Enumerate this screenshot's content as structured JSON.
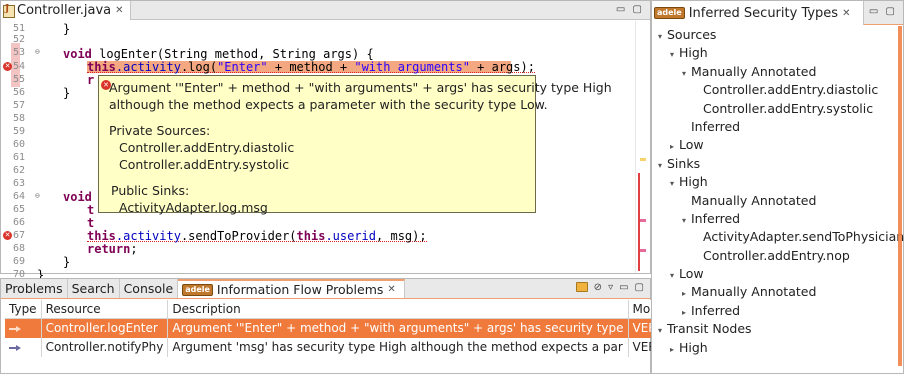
{
  "editor": {
    "tab_title": "Controller.java",
    "tab_close": "✕",
    "window_controls": "▭ ▢",
    "line_numbers": [
      "51",
      "52",
      "53",
      "54",
      "55",
      "56",
      "57",
      "58",
      "59",
      "60",
      "61",
      "62",
      "63",
      "64",
      "65",
      "66",
      "67",
      "68",
      "69",
      "70"
    ],
    "code": {
      "l51": "}",
      "l53_kw": "void",
      "l53_rest": " logEnter(String method, String args) {",
      "l54_this": "this",
      "l54_fld": ".activity",
      "l54_a": ".log(",
      "l54_s1": "\"Enter\"",
      "l54_b": " + method + ",
      "l54_s2": "\"with arguments\"",
      "l54_c": " + args);",
      "l55": "r",
      "l56": "}",
      "l64_kw": "void",
      "l65": "t",
      "l66": "t",
      "l67_this": "this",
      "l67_fld": ".activity",
      "l67_a": ".sendToProvider(",
      "l67_this2": "this",
      "l67_fld2": ".userid",
      "l67_b": ", msg);",
      "l68_kw": "return",
      "l68_b": ";",
      "l69": "}",
      "l70": "}"
    },
    "tooltip": {
      "line1": "Argument '\"Enter\" + method + \"with arguments\" + args' has security type High",
      "line2": "although the method expects a parameter with the security type Low.",
      "private_heading": "Private Sources:",
      "private_1": "Controller.addEntry.diastolic",
      "private_2": "Controller.addEntry.systolic",
      "public_heading": "Public Sinks:",
      "public_1": "ActivityAdapter.log.msg"
    }
  },
  "bottom_panel": {
    "tabs": [
      "Problems",
      "Search",
      "Console"
    ],
    "active_tab_badge": "adele",
    "active_tab": "Information Flow Problems",
    "active_tab_close": "✕",
    "columns": [
      "Type",
      "Resource",
      "Description",
      "Module"
    ],
    "rows": [
      {
        "resource": "Controller.logEnter",
        "description": "Argument '\"Enter\" + method + \"with arguments\" + args' has security type",
        "module": "VERIFIER"
      },
      {
        "resource": "Controller.notifyPhy",
        "description": "Argument 'msg' has security type High although the method expects a par",
        "module": "VERIFIER"
      }
    ],
    "toolbar_icons": [
      "▿",
      "▭",
      "▢"
    ]
  },
  "right_panel": {
    "badge": "adele",
    "title": "Inferred Security Types",
    "close": "✕",
    "window_controls": "▭ ▢",
    "tree": [
      {
        "label": "Sources",
        "level": 0,
        "state": "open"
      },
      {
        "label": "High",
        "level": 1,
        "state": "open"
      },
      {
        "label": "Manually Annotated",
        "level": 2,
        "state": "open"
      },
      {
        "label": "Controller.addEntry.diastolic",
        "level": 3,
        "state": "leaf"
      },
      {
        "label": "Controller.addEntry.systolic",
        "level": 3,
        "state": "leaf"
      },
      {
        "label": "Inferred",
        "level": 2,
        "state": "leaf"
      },
      {
        "label": "Low",
        "level": 1,
        "state": "closed"
      },
      {
        "label": "Sinks",
        "level": 0,
        "state": "open"
      },
      {
        "label": "High",
        "level": 1,
        "state": "open"
      },
      {
        "label": "Manually Annotated",
        "level": 2,
        "state": "leaf"
      },
      {
        "label": "Inferred",
        "level": 2,
        "state": "open"
      },
      {
        "label": "ActivityAdapter.sendToPhysician.msg",
        "level": 3,
        "state": "leaf"
      },
      {
        "label": "Controller.addEntry.nop",
        "level": 3,
        "state": "leaf"
      },
      {
        "label": "Low",
        "level": 1,
        "state": "open"
      },
      {
        "label": "Manually Annotated",
        "level": 2,
        "state": "closed"
      },
      {
        "label": "Inferred",
        "level": 2,
        "state": "closed"
      },
      {
        "label": "Transit Nodes",
        "level": 0,
        "state": "open"
      },
      {
        "label": "High",
        "level": 1,
        "state": "closed"
      }
    ]
  },
  "colors": {
    "accent": "#f07a3c",
    "error": "#d9342b",
    "tooltip_bg": "#ffffc6",
    "keyword": "#7f0055",
    "string": "#2a00ff",
    "field": "#0000c0"
  }
}
